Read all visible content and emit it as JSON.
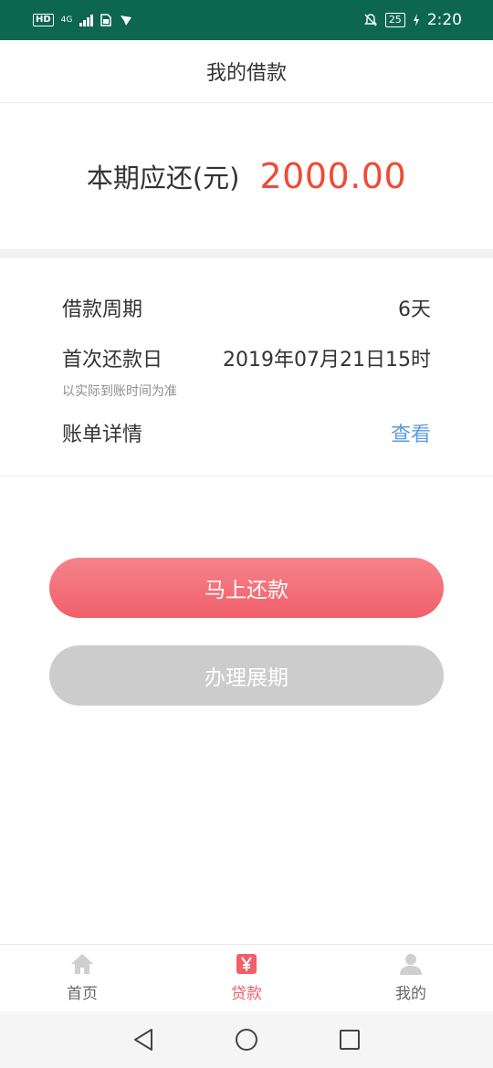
{
  "status_bar": {
    "network_badge": "HD",
    "network_type": "4G",
    "battery": "25",
    "time": "2:20"
  },
  "header": {
    "title": "我的借款"
  },
  "amount": {
    "label": "本期应还(元)",
    "value": "2000.00"
  },
  "details": {
    "period_label": "借款周期",
    "period_value": "6天",
    "first_repay_label": "首次还款日",
    "first_repay_value": "2019年07月21日15时",
    "first_repay_hint": "以实际到账时间为准",
    "bill_label": "账单详情",
    "bill_action": "查看"
  },
  "buttons": {
    "repay": "马上还款",
    "extend": "办理展期"
  },
  "tabbar": {
    "items": [
      {
        "label": "首页",
        "icon": "home-icon",
        "active": false
      },
      {
        "label": "贷款",
        "icon": "yen-icon",
        "active": true
      },
      {
        "label": "我的",
        "icon": "user-icon",
        "active": false
      }
    ]
  },
  "colors": {
    "status_bar": "#0c6650",
    "accent_red": "#ef4a35",
    "button_pink": "#f0606b",
    "link_blue": "#5b9be0",
    "disabled_gray": "#cccccc"
  }
}
